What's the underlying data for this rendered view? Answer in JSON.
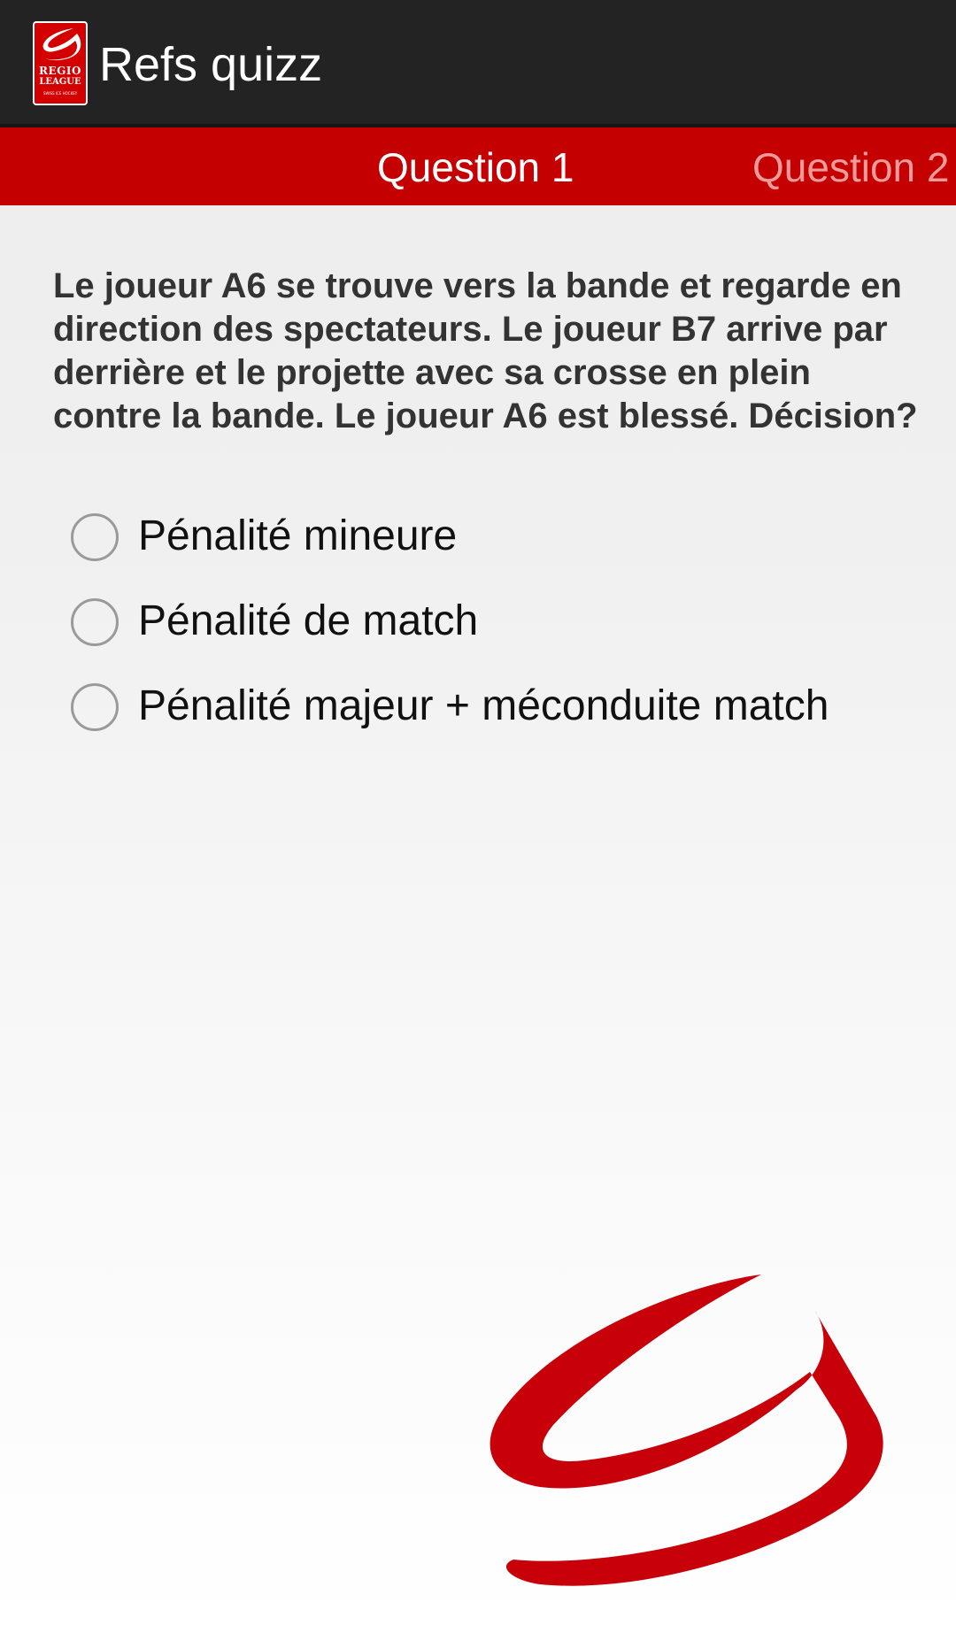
{
  "app": {
    "title": "Refs quizz",
    "logo": {
      "line1": "REGIO",
      "line2": "LEAGUE",
      "line3": "SWISS ICE HOCKEY",
      "icon": "regio-league-logo"
    }
  },
  "tabs": [
    {
      "label": "Question 1",
      "active": true
    },
    {
      "label": "Question 2",
      "active": false
    }
  ],
  "question": {
    "text": "Le joueur A6 se trouve vers la bande et regarde en direction des spectateurs. Le joueur B7 arrive par derrière et le projette avec sa crosse en plein contre la bande. Le joueur A6 est blessé. Décision?",
    "options": [
      {
        "label": "Pénalité mineure",
        "selected": false
      },
      {
        "label": "Pénalité de match",
        "selected": false
      },
      {
        "label": "Pénalité majeur + méconduite match",
        "selected": false
      }
    ]
  },
  "colors": {
    "action_bar": "#232323",
    "tab_strip": "#c40000",
    "tab_inactive_text": "#f29a9a",
    "brand_red": "#c8000a"
  },
  "icons": {
    "radio": "radio-unchecked-icon",
    "watermark": "regio-league-swoosh"
  }
}
